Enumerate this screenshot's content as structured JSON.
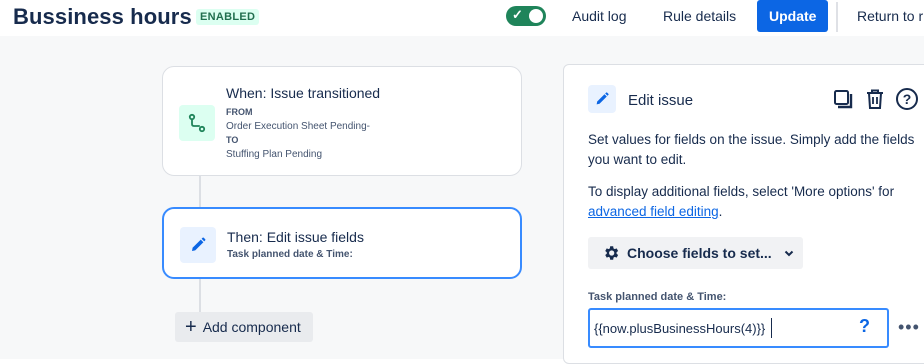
{
  "header": {
    "title": "Bussiness hours",
    "status_badge": "ENABLED",
    "toggle_state": "on",
    "audit_log": "Audit log",
    "rule_details": "Rule details",
    "update": "Update",
    "return": "Return to r"
  },
  "trigger": {
    "title": "When: Issue transitioned",
    "from_label": "FROM",
    "from_value": "Order Execution Sheet Pending-",
    "to_label": "TO",
    "to_value": "Stuffing Plan Pending",
    "icon": "transition-icon"
  },
  "action": {
    "title": "Then: Edit issue fields",
    "subtitle": "Task planned date & Time:",
    "icon": "pencil-icon"
  },
  "add_component": "Add component",
  "panel": {
    "title": "Edit issue",
    "description": "Set values for fields on the issue. Simply add the fields you want to edit.",
    "more_options_prefix": "To display additional fields, select 'More options' for",
    "advanced_link": "advanced field editing",
    "period": ".",
    "choose_fields": "Choose fields to set...",
    "field_label": "Task planned date & Time:",
    "field_value": "{{now.plusBusinessHours(4)}}",
    "help": "?",
    "more": "•••"
  },
  "colors": {
    "primary": "#0c66e4",
    "enabled_green": "#1f845a",
    "badge_bg": "#dcfff1",
    "selected_border": "#388bff"
  }
}
